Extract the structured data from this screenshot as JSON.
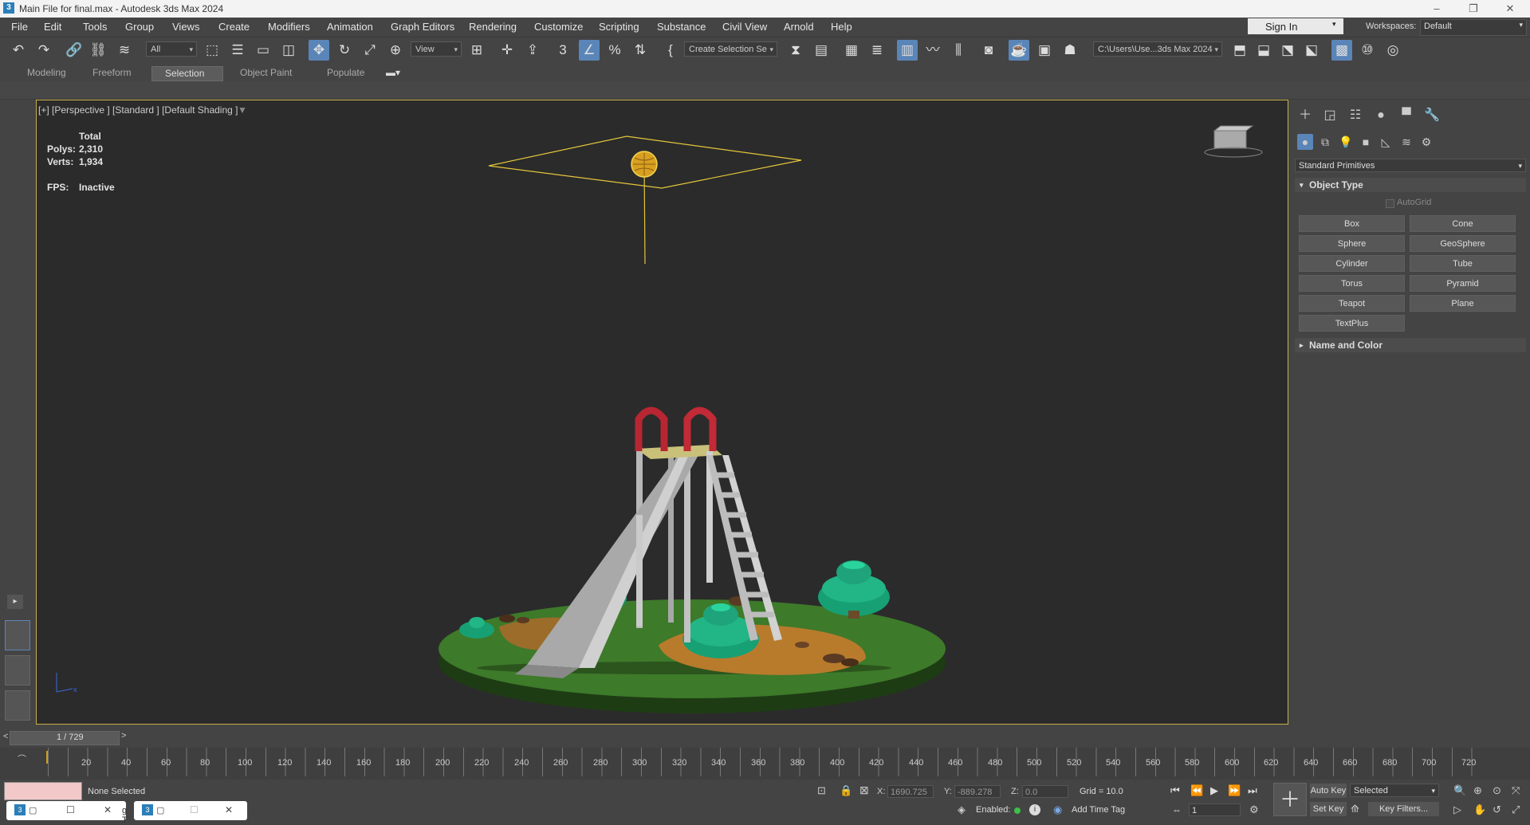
{
  "title_bar": {
    "app_icon": "3",
    "title": "Main File for final.max - Autodesk 3ds Max 2024",
    "minimize": "–",
    "restore": "❐",
    "close": "✕"
  },
  "menu": [
    "File",
    "Edit",
    "Tools",
    "Group",
    "Views",
    "Create",
    "Modifiers",
    "Animation",
    "Graph Editors",
    "Rendering",
    "Customize",
    "Scripting",
    "Substance",
    "Civil View",
    "Arnold",
    "Help"
  ],
  "account": {
    "sign_in": "Sign In",
    "workspaces_label": "Workspaces:",
    "workspace": "Default"
  },
  "toolbar": {
    "selection_filter": "All",
    "ref_coord": "View",
    "named_selection": "Create Selection Se",
    "project_path": "C:\\Users\\Use...3ds Max 2024"
  },
  "ribbon_tabs": [
    "Modeling",
    "Freeform",
    "Selection",
    "Object Paint",
    "Populate"
  ],
  "ribbon_selected": "Selection",
  "viewport": {
    "label": "[+] [Perspective ] [Standard ] [Default Shading ]",
    "stats": {
      "total_label": "Total",
      "polys_label": "Polys:",
      "polys": "2,310",
      "verts_label": "Verts:",
      "verts": "1,934",
      "fps_label": "FPS:",
      "fps": "Inactive"
    }
  },
  "command_panel": {
    "category": "Standard Primitives",
    "object_type_title": "Object Type",
    "autogrid": "AutoGrid",
    "buttons": [
      "Box",
      "Cone",
      "Sphere",
      "GeoSphere",
      "Cylinder",
      "Tube",
      "Torus",
      "Pyramid",
      "Teapot",
      "Plane",
      "TextPlus"
    ],
    "name_and_color_title": "Name and Color"
  },
  "timeline": {
    "frame_display": "1 / 729",
    "ticks": [
      "20",
      "40",
      "60",
      "80",
      "100",
      "120",
      "140",
      "160",
      "180",
      "200",
      "220",
      "240",
      "260",
      "280",
      "300",
      "320",
      "340",
      "360",
      "380",
      "400",
      "420",
      "440",
      "460",
      "480",
      "500",
      "520",
      "540",
      "560",
      "580",
      "600",
      "620",
      "640",
      "660",
      "680",
      "700",
      "720"
    ]
  },
  "status": {
    "selection": "None Selected",
    "x_label": "X:",
    "x": "1690.725",
    "y_label": "Y:",
    "y": "-889.278",
    "z_label": "Z:",
    "z": "0.0",
    "grid": "Grid = 10.0",
    "enabled_label": "Enabled:",
    "add_time_tag": "Add Time Tag",
    "auto_key": "Auto Key",
    "key_mode": "Selected",
    "set_key": "Set Key",
    "key_filters": "Key Filters...",
    "current_frame": "1",
    "taskbar_partial": "g T"
  }
}
